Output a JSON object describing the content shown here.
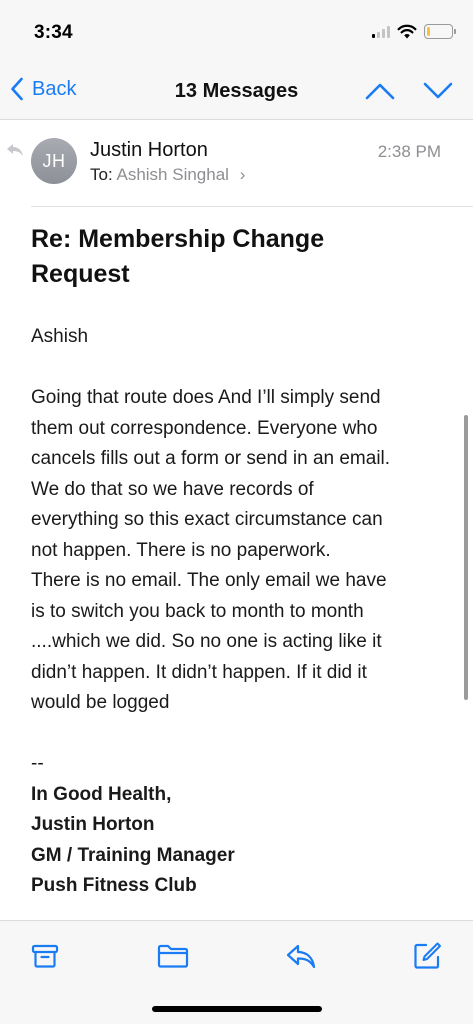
{
  "status_bar": {
    "time": "3:34",
    "signal_bars_active": 1,
    "battery_level": 0.15,
    "battery_color": "#f6c342",
    "icons": [
      "cellular-signal-icon",
      "wifi-icon",
      "battery-icon"
    ]
  },
  "nav": {
    "back_label": "Back",
    "title": "13 Messages",
    "accent": "#1a7cf5",
    "icons": [
      "chevron-left-icon",
      "chevron-up-icon",
      "chevron-down-icon"
    ]
  },
  "message": {
    "avatar_initials": "JH",
    "sender": "Justin Horton",
    "to_label": "To:",
    "recipient": "Ashish Singhal",
    "time": "2:38 PM",
    "subject_line1": "Re: Membership Change",
    "subject_line2": "Request",
    "greeting": "Ashish",
    "body_lines": [
      "Going that route does   And I’ll simply send",
      "them out correspondence.   Everyone who",
      "cancels fills out a form or send in an email.",
      "We do that so we have records of",
      "everything so this exact circumstance can",
      "not happen.    There is no paperwork.",
      "There is no email.  The only email we have",
      "is to switch you back to month to month",
      "....which we did.   So no one is acting like it",
      "didn’t happen.  It didn’t happen.  If it did it",
      "would be logged"
    ],
    "sig_separator": "--",
    "signature": [
      "In Good Health,",
      "Justin Horton",
      "GM / Training Manager",
      "Push Fitness Club"
    ]
  },
  "toolbar": {
    "icons": [
      "archive-icon",
      "folder-icon",
      "reply-icon",
      "compose-icon"
    ]
  }
}
